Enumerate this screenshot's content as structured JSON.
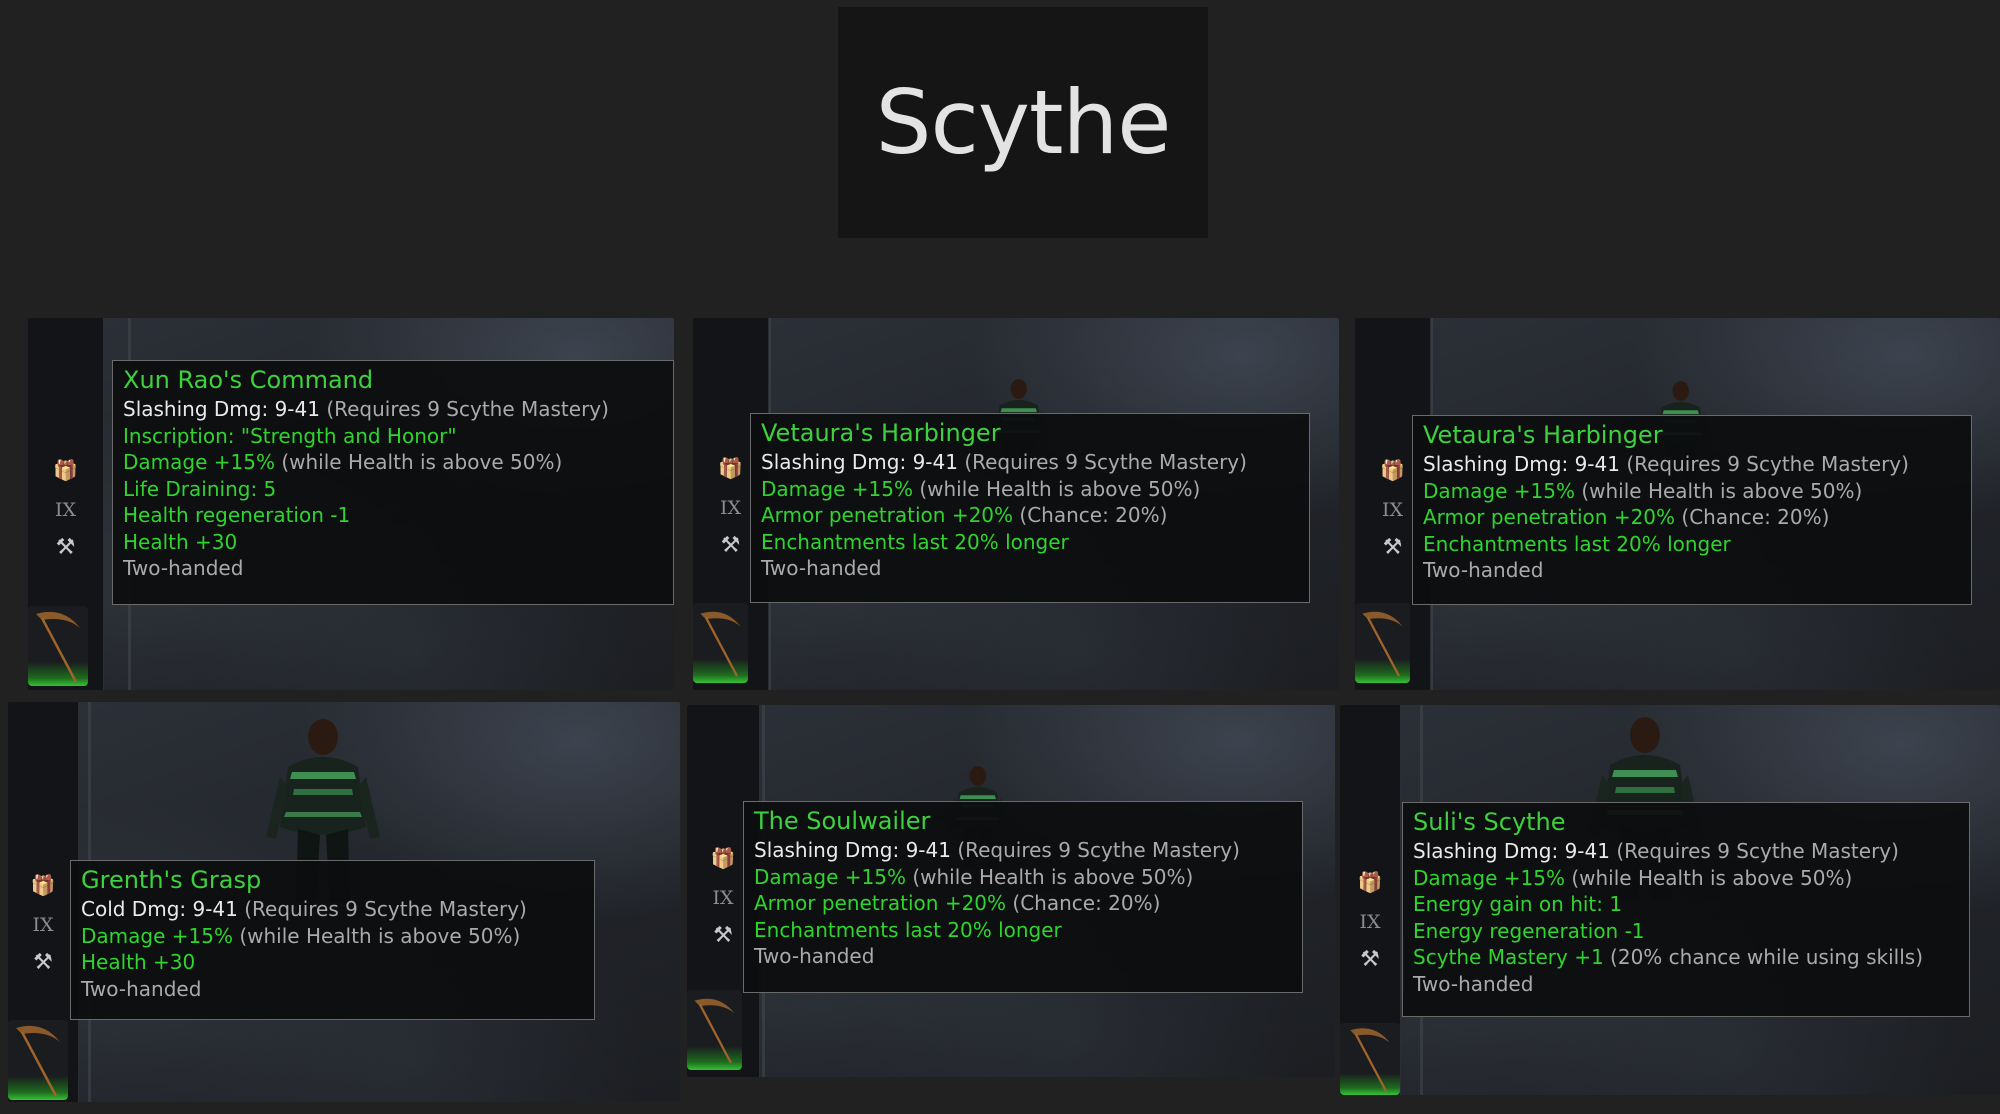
{
  "page_title": "Scythe",
  "colors": {
    "item_name": "#3ed13e",
    "mod_green": "#2fd42f",
    "base_white": "#eaeaea",
    "note_gray": "#aaaaaa",
    "background": "#212121"
  },
  "hud_icons": {
    "gift": "gift-box-icon",
    "ix": "IX",
    "hammer": "hammer-icon"
  },
  "items": [
    {
      "name": "Xun Rao's Command",
      "base": {
        "damage": "Slashing Dmg: 9-41",
        "requirement": "(Requires 9 Scythe Mastery)"
      },
      "mods": [
        {
          "text": "Inscription: \"Strength and Honor\"",
          "note": ""
        },
        {
          "text": "Damage +15%",
          "note": "(while Health is above 50%)"
        },
        {
          "text": "Life Draining: 5",
          "note": ""
        },
        {
          "text": "Health regeneration -1",
          "note": ""
        },
        {
          "text": "Health +30",
          "note": ""
        }
      ],
      "footer": "Two-handed"
    },
    {
      "name": "Vetaura's Harbinger",
      "base": {
        "damage": "Slashing Dmg: 9-41",
        "requirement": "(Requires 9 Scythe Mastery)"
      },
      "mods": [
        {
          "text": "Damage +15%",
          "note": "(while Health is above 50%)"
        },
        {
          "text": "Armor penetration +20%",
          "note": "(Chance: 20%)"
        },
        {
          "text": "Enchantments last 20% longer",
          "note": ""
        }
      ],
      "footer": "Two-handed"
    },
    {
      "name": "Vetaura's Harbinger",
      "base": {
        "damage": "Slashing Dmg: 9-41",
        "requirement": "(Requires 9 Scythe Mastery)"
      },
      "mods": [
        {
          "text": "Damage +15%",
          "note": "(while Health is above 50%)"
        },
        {
          "text": "Armor penetration +20%",
          "note": "(Chance: 20%)"
        },
        {
          "text": "Enchantments last 20% longer",
          "note": ""
        }
      ],
      "footer": "Two-handed"
    },
    {
      "name": "Grenth's Grasp",
      "base": {
        "damage": "Cold Dmg: 9-41",
        "requirement": "(Requires 9 Scythe Mastery)"
      },
      "mods": [
        {
          "text": "Damage +15%",
          "note": "(while Health is above 50%)"
        },
        {
          "text": "Health +30",
          "note": ""
        }
      ],
      "footer": "Two-handed"
    },
    {
      "name": "The Soulwailer",
      "base": {
        "damage": "Slashing Dmg: 9-41",
        "requirement": "(Requires 9 Scythe Mastery)"
      },
      "mods": [
        {
          "text": "Damage +15%",
          "note": "(while Health is above 50%)"
        },
        {
          "text": "Armor penetration +20%",
          "note": "(Chance: 20%)"
        },
        {
          "text": "Enchantments last 20% longer",
          "note": ""
        }
      ],
      "footer": "Two-handed"
    },
    {
      "name": "Suli's Scythe",
      "base": {
        "damage": "Slashing Dmg: 9-41",
        "requirement": "(Requires 9 Scythe Mastery)"
      },
      "mods": [
        {
          "text": "Damage +15%",
          "note": "(while Health is above 50%)"
        },
        {
          "text": "Energy gain on hit: 1",
          "note": ""
        },
        {
          "text": "Energy regeneration -1",
          "note": ""
        },
        {
          "text": "Scythe Mastery +1",
          "note": "(20% chance while using skills)"
        }
      ],
      "footer": "Two-handed"
    }
  ]
}
